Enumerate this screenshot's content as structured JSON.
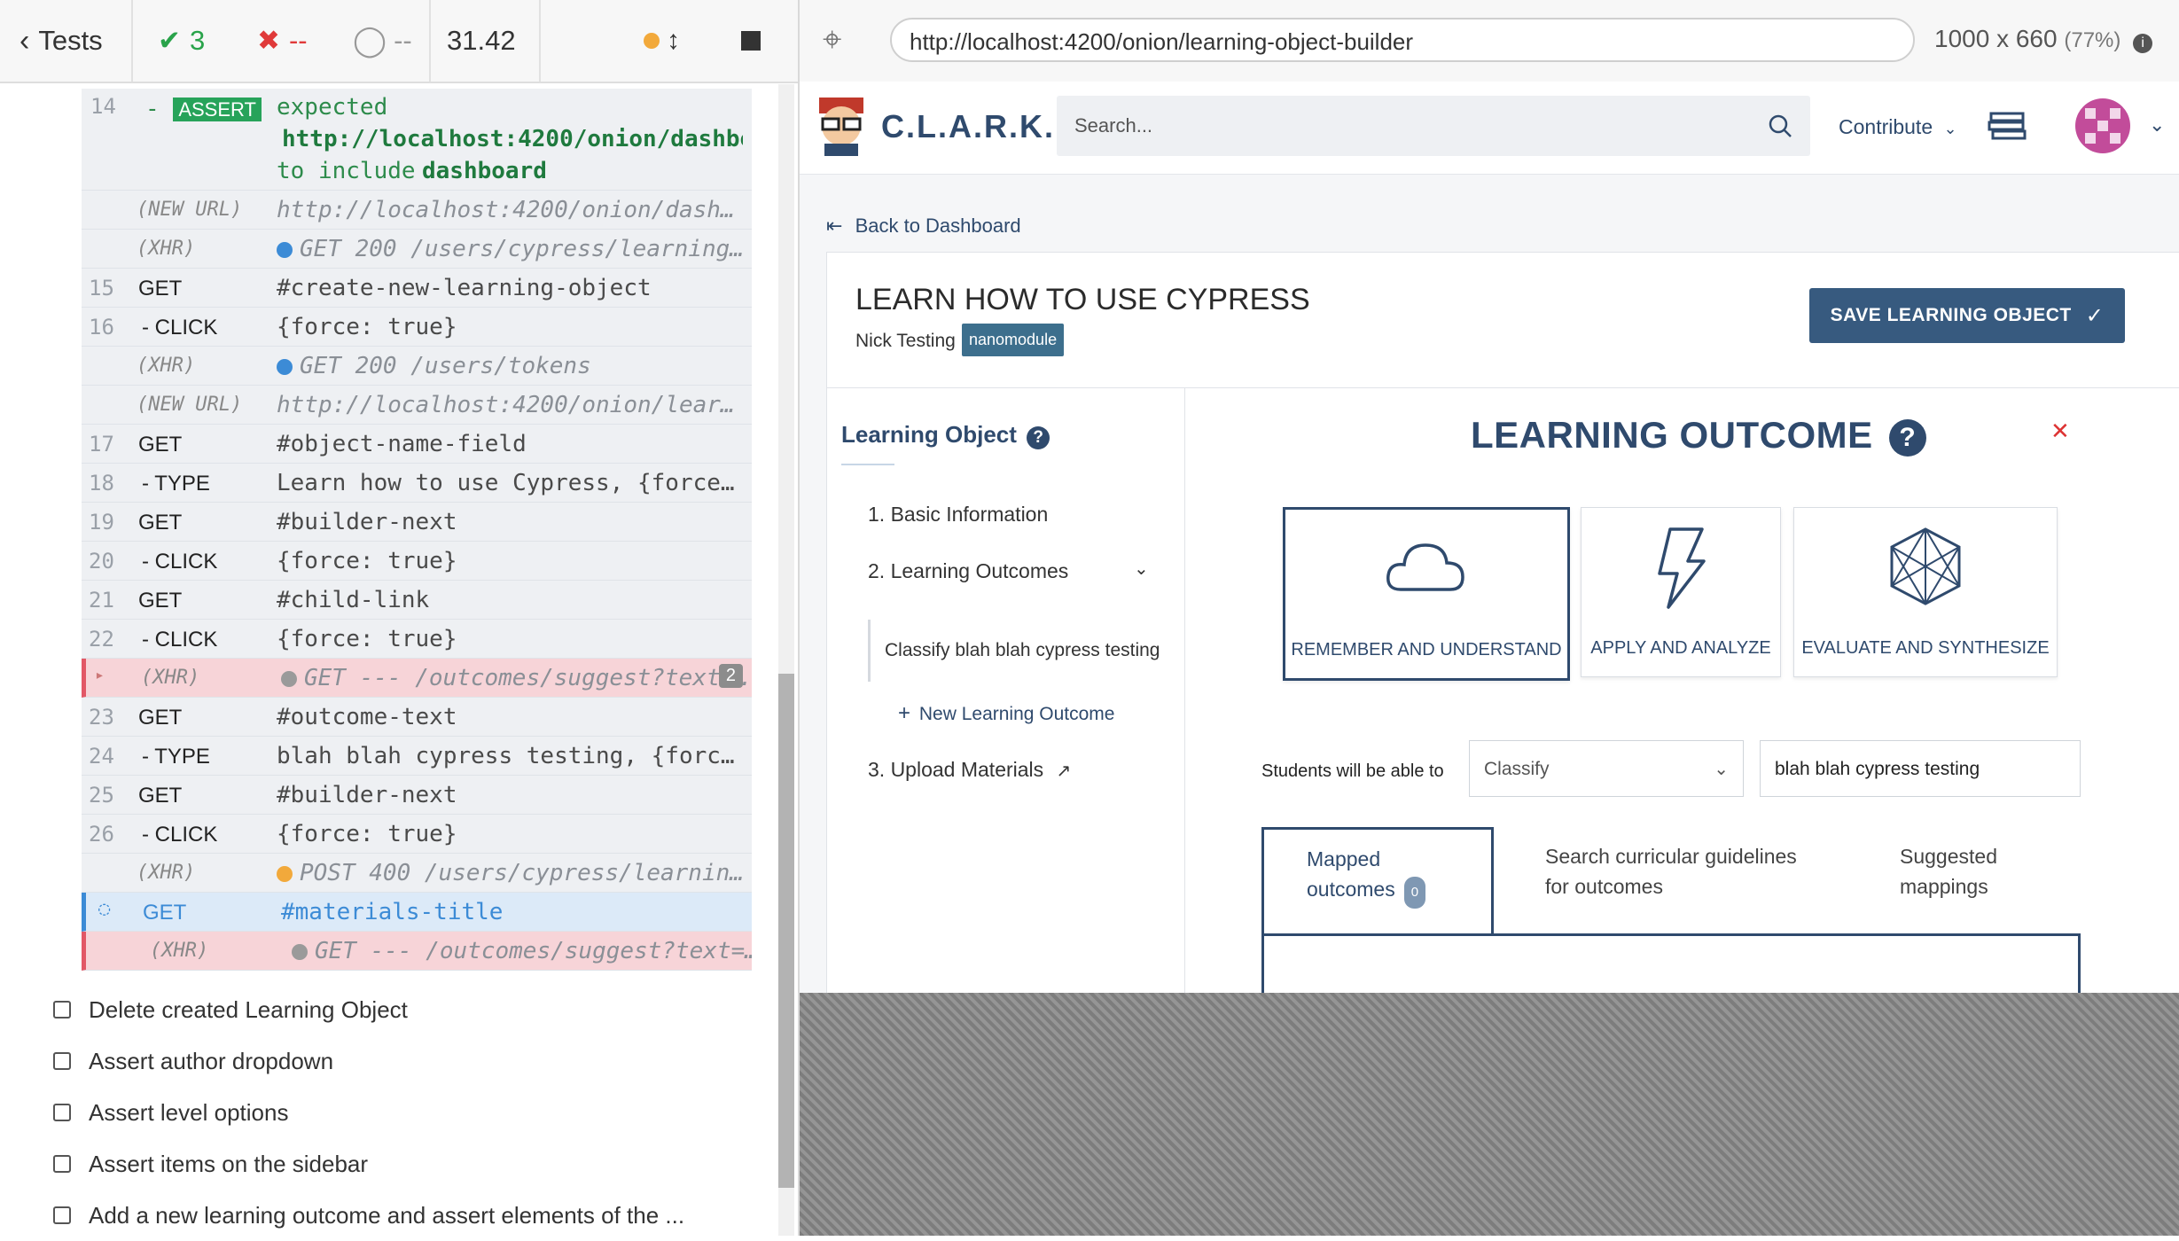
{
  "runner": {
    "back_label": "Tests",
    "passed": "3",
    "failed": "--",
    "pending": "--",
    "duration": "31.42",
    "commands": [
      {
        "num": "15",
        "name": "GET",
        "msg": "#create-new-learning-object"
      },
      {
        "num": "16",
        "name": "- CLICK",
        "msg": "{force: true}"
      },
      {
        "num": "",
        "name": "(XHR)",
        "msg": "GET 200 /users/tokens"
      },
      {
        "num": "",
        "name": "(NEW URL)",
        "msg": "http://localhost:4200/onion/learnin…"
      },
      {
        "num": "17",
        "name": "GET",
        "msg": "#object-name-field"
      },
      {
        "num": "18",
        "name": "- TYPE",
        "msg": "Learn how to use Cypress, {force: t…"
      },
      {
        "num": "19",
        "name": "GET",
        "msg": "#builder-next"
      },
      {
        "num": "20",
        "name": "- CLICK",
        "msg": "{force: true}"
      },
      {
        "num": "21",
        "name": "GET",
        "msg": "#child-link"
      },
      {
        "num": "22",
        "name": "- CLICK",
        "msg": "{force: true}"
      },
      {
        "num": "",
        "name": "(XHR)",
        "msg": "GET --- /outcomes/suggest?text=…",
        "count": "2"
      },
      {
        "num": "23",
        "name": "GET",
        "msg": "#outcome-text"
      },
      {
        "num": "24",
        "name": "- TYPE",
        "msg": "blah blah cypress testing, {force: …"
      },
      {
        "num": "25",
        "name": "GET",
        "msg": "#builder-next"
      },
      {
        "num": "26",
        "name": "- CLICK",
        "msg": "{force: true}"
      },
      {
        "num": "",
        "name": "(XHR)",
        "msg": "POST 400 /users/cypress/learning-…"
      },
      {
        "num": "",
        "name": "GET",
        "msg": "#materials-title"
      },
      {
        "num": "",
        "name": "(XHR)",
        "msg": "GET --- /outcomes/suggest?text=b…"
      }
    ],
    "assert_row": {
      "num": "14",
      "badge": "ASSERT",
      "line1": "expected",
      "line2": "http://localhost:4200/onion/dashboa…",
      "line3a": "to include",
      "line3b": "dashboard"
    },
    "pre_rows": [
      {
        "name": "(NEW URL)",
        "msg": "http://localhost:4200/onion/dashboa…"
      },
      {
        "name": "(XHR)",
        "msg": "GET 200 /users/cypress/learning-o…"
      }
    ],
    "tests": [
      "Delete created Learning Object",
      "Assert author dropdown",
      "Assert level options",
      "Assert items on the sidebar",
      "Add a new learning outcome and assert elements of the ..."
    ]
  },
  "browser": {
    "url": "http://localhost:4200/onion/learning-object-builder",
    "size": "1000 x 660",
    "zoom": "(77%)"
  },
  "app": {
    "logo": "C.L.A.R.K.",
    "search_placeholder": "Search...",
    "contribute": "Contribute",
    "back_link": "Back to Dashboard",
    "title": "LEARN HOW TO USE CYPRESS",
    "author": "Nick Testing",
    "badge": "nanomodule",
    "save_button": "SAVE LEARNING OBJECT",
    "sidebar": {
      "title": "Learning Object",
      "items": [
        "1. Basic Information",
        "2. Learning Outcomes",
        "3. Upload Materials"
      ],
      "sub_item": "Classify blah blah cypress testing",
      "new_outcome": "New Learning Outcome"
    },
    "outcome": {
      "title": "LEARNING OUTCOME",
      "categories": [
        "REMEMBER AND UNDERSTAND",
        "APPLY AND ANALYZE",
        "EVALUATE AND SYNTHESIZE"
      ],
      "able_label": "Students will be able to",
      "verb": "Classify",
      "text": "blah blah cypress testing",
      "tabs": {
        "mapped_line1": "Mapped",
        "mapped_line2": "outcomes",
        "mapped_count": "0",
        "search_line1": "Search curricular guidelines",
        "search_line2": "for outcomes",
        "suggested_line1": "Suggested",
        "suggested_line2": "mappings"
      }
    }
  },
  "colors": {
    "accent": "#2f4a6d",
    "pass": "#29a34a",
    "fail": "#e03a3a",
    "xhr_blue": "#3c8bd6",
    "xhr_orange": "#f2a93b"
  }
}
